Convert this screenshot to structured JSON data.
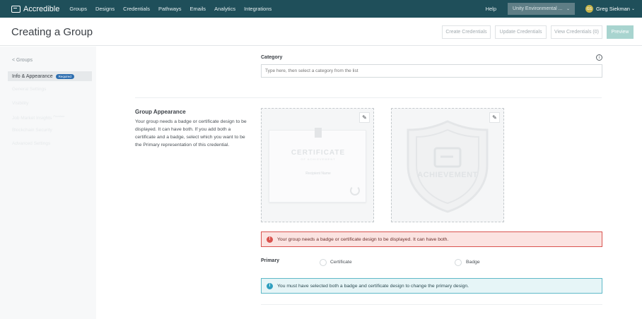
{
  "topbar": {
    "brand": "Accredible",
    "nav": [
      "Groups",
      "Designs",
      "Credentials",
      "Pathways",
      "Emails",
      "Analytics",
      "Integrations"
    ],
    "help": "Help",
    "org": "Unity Environmental ...",
    "user": "Greg Siekman",
    "user_initials": "GS"
  },
  "header": {
    "title": "Creating a Group",
    "buttons": {
      "create": "Create Credentials",
      "update": "Update Credentials",
      "view": "View Credentials (0)",
      "preview": "Preview"
    }
  },
  "sidebar": {
    "back": "< Groups",
    "active": "Info & Appearance",
    "required_badge": "Required",
    "items": [
      "General Settings",
      "Visibility",
      "Job Market Insights",
      "Blockchain Security",
      "Advanced Settings"
    ],
    "new_badge": "Premium"
  },
  "category": {
    "label": "Category",
    "placeholder": "Type here, then select a category from the list"
  },
  "appearance": {
    "title": "Group Appearance",
    "description": "Your group needs a badge or certificate design to be displayed. It can have both. If you add both a certificate and a badge, select which you want to be the Primary representation of this credential.",
    "certificate_preview": {
      "title": "CERTIFICATE",
      "subtitle": "OF ACHIEVEMENT",
      "recipient": "Recipient Name"
    },
    "badge_preview": {
      "title": "ACHIEVEMENT"
    }
  },
  "error_alert": "Your group needs a badge or certificate design to be displayed. It can have both.",
  "primary": {
    "label": "Primary",
    "options": [
      "Certificate",
      "Badge"
    ]
  },
  "info_alert": "You must have selected both a badge and certificate design to change the primary design.",
  "colors": {
    "topbar": "#1f4f5a",
    "error": "#d9534f",
    "info": "#5fb9c8",
    "required_badge": "#2f6fb0"
  }
}
